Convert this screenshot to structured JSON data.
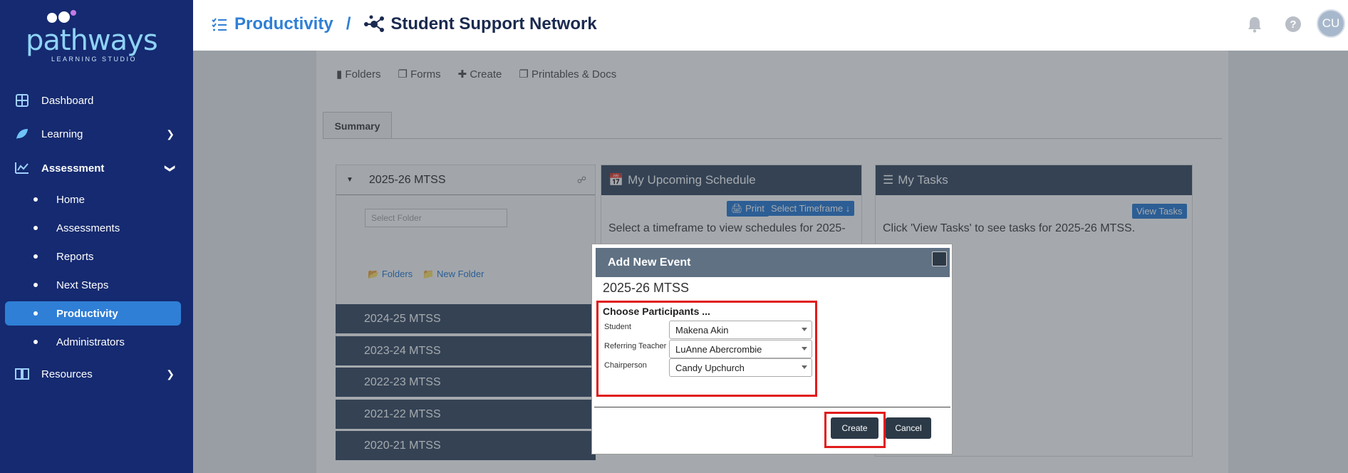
{
  "brand": {
    "name": "pathways",
    "tagline": "LEARNING STUDIO"
  },
  "sidebar": {
    "items": [
      {
        "label": "Dashboard",
        "icon": "grid-icon"
      },
      {
        "label": "Learning",
        "icon": "leaf-icon"
      },
      {
        "label": "Assessment",
        "icon": "chart-line-icon"
      },
      {
        "label": "Resources",
        "icon": "book-icon"
      }
    ],
    "assessment_sub": [
      {
        "label": "Home"
      },
      {
        "label": "Assessments"
      },
      {
        "label": "Reports"
      },
      {
        "label": "Next Steps"
      },
      {
        "label": "Productivity",
        "active": true
      },
      {
        "label": "Administrators"
      }
    ]
  },
  "header": {
    "breadcrumb_root": "Productivity",
    "separator": "/",
    "breadcrumb_current": "Student Support Network",
    "avatar_initials": "CU"
  },
  "toolbar": {
    "folders": "Folders",
    "forms": "Forms",
    "create": "Create",
    "printables": "Printables & Docs"
  },
  "tabs": {
    "summary": "Summary"
  },
  "folder_panel": {
    "current": "2025-26 MTSS",
    "select_placeholder": "Select Folder",
    "link_folders": "Folders",
    "link_new_folder": "New Folder",
    "other_years": [
      "2024-25 MTSS",
      "2023-24 MTSS",
      "2022-23 MTSS",
      "2021-22 MTSS",
      "2020-21 MTSS"
    ]
  },
  "schedule_card": {
    "title": "My Upcoming Schedule",
    "print": "Print",
    "timeframe": "Select Timeframe",
    "text": "Select a timeframe to view schedules for 2025-"
  },
  "tasks_card": {
    "title": "My Tasks",
    "view_tasks": "View Tasks",
    "text": "Click 'View Tasks' to see tasks for 2025-26 MTSS."
  },
  "modal": {
    "title": "Add New Event",
    "subtitle": "2025-26 MTSS",
    "participants_heading": "Choose Participants ...",
    "fields": [
      {
        "label": "Student",
        "value": "Makena Akin"
      },
      {
        "label": "Referring Teacher",
        "value": "LuAnne Abercrombie"
      },
      {
        "label": "Chairperson",
        "value": "Candy Upchurch"
      }
    ],
    "create_label": "Create",
    "cancel_label": "Cancel"
  },
  "colors": {
    "sidebar": "#152a70",
    "accent": "#2f7fd6",
    "highlight": "#e11b1b"
  }
}
